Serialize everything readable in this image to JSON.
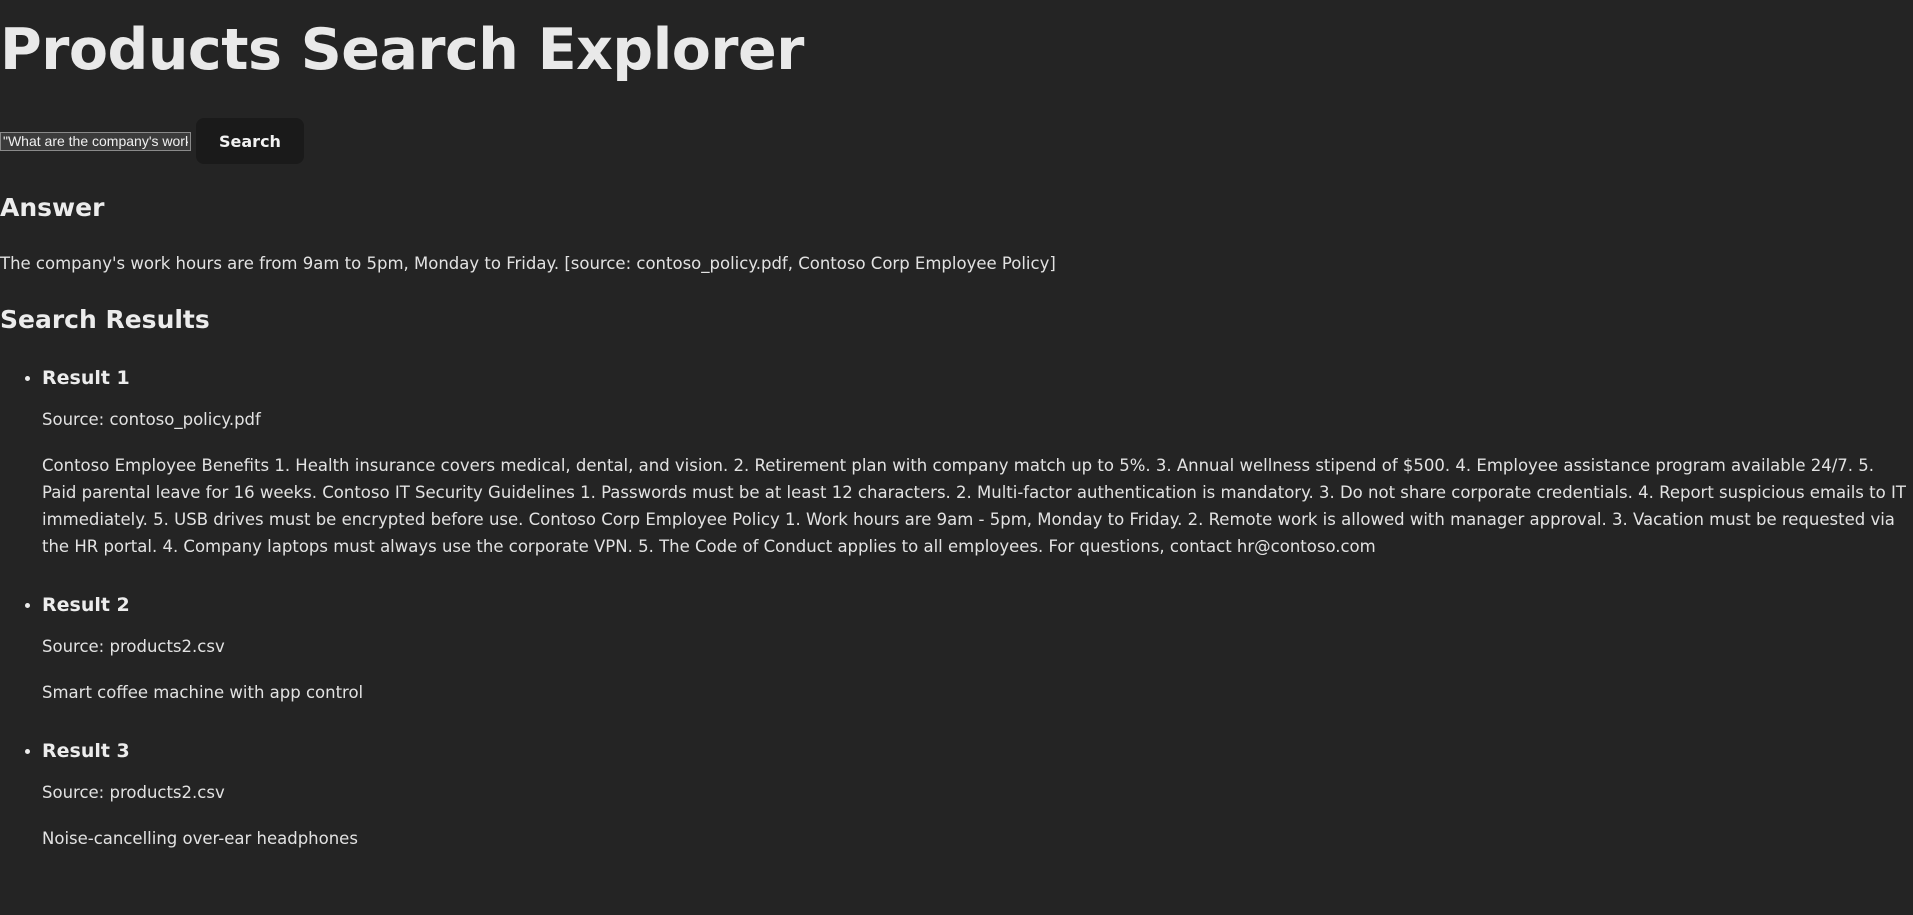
{
  "app": {
    "title": "Products Search Explorer"
  },
  "search": {
    "value": "\"What are the company's work hours?\"",
    "button_label": "Search"
  },
  "answer": {
    "heading": "Answer",
    "text": "The company's work hours are from 9am to 5pm, Monday to Friday. [source: contoso_policy.pdf, Contoso Corp Employee Policy]"
  },
  "results": {
    "heading": "Search Results",
    "items": [
      {
        "title": "Result 1",
        "source": "Source: contoso_policy.pdf",
        "content": "Contoso Employee Benefits 1. Health insurance covers medical, dental, and vision. 2. Retirement plan with company match up to 5%. 3. Annual wellness stipend of $500. 4. Employee assistance program available 24/7. 5. Paid parental leave for 16 weeks. Contoso IT Security Guidelines 1. Passwords must be at least 12 characters. 2. Multi-factor authentication is mandatory. 3. Do not share corporate credentials. 4. Report suspicious emails to IT immediately. 5. USB drives must be encrypted before use. Contoso Corp Employee Policy 1. Work hours are 9am - 5pm, Monday to Friday. 2. Remote work is allowed with manager approval. 3. Vacation must be requested via the HR portal. 4. Company laptops must always use the corporate VPN. 5. The Code of Conduct applies to all employees. For questions, contact hr@contoso.com"
      },
      {
        "title": "Result 2",
        "source": "Source: products2.csv",
        "content": "Smart coffee machine with app control"
      },
      {
        "title": "Result 3",
        "source": "Source: products2.csv",
        "content": "Noise-cancelling over-ear headphones"
      }
    ]
  }
}
